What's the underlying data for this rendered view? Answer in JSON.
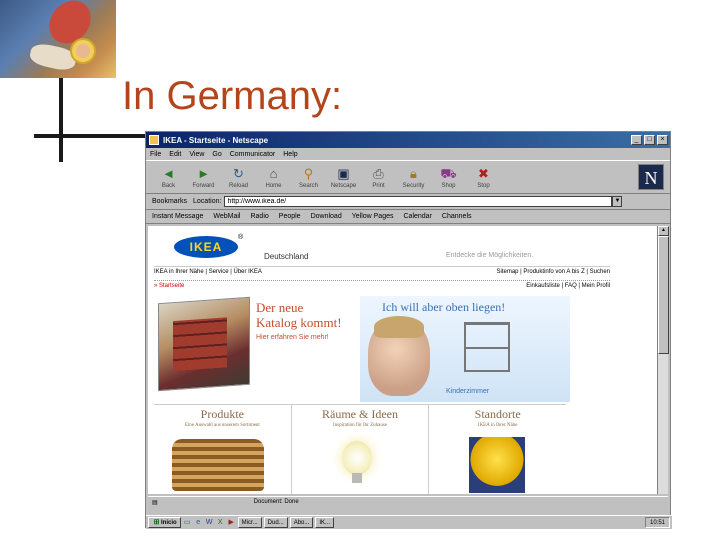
{
  "slide": {
    "title": "In Germany:"
  },
  "browser": {
    "window_title": "IKEA - Startseite - Netscape",
    "menu": [
      "File",
      "Edit",
      "View",
      "Go",
      "Communicator",
      "Help"
    ],
    "toolbar": [
      {
        "label": "Back",
        "icon": "back-icon"
      },
      {
        "label": "Forward",
        "icon": "forward-icon"
      },
      {
        "label": "Reload",
        "icon": "reload-icon"
      },
      {
        "label": "Home",
        "icon": "home-icon"
      },
      {
        "label": "Search",
        "icon": "search-icon"
      },
      {
        "label": "Netscape",
        "icon": "netscape-icon"
      },
      {
        "label": "Print",
        "icon": "print-icon"
      },
      {
        "label": "Security",
        "icon": "security-icon"
      },
      {
        "label": "Shop",
        "icon": "shop-icon"
      },
      {
        "label": "Stop",
        "icon": "stop-icon"
      }
    ],
    "bookmarks_label": "Bookmarks",
    "location_label": "Location:",
    "url": "http://www.ikea.de/",
    "personal": [
      "Instant Message",
      "WebMail",
      "Radio",
      "People",
      "Download",
      "Yellow Pages",
      "Calendar",
      "Channels"
    ],
    "status_text": "Document: Done"
  },
  "ikea": {
    "logo": "IKEA",
    "reg": "®",
    "country": "Deutschland",
    "discover": "Entdecke die Möglichkeiten.",
    "nav_left": "IKEA in Ihrer Nähe | Service | Über IKEA",
    "nav_right": "Sitemap | Produktinfo von A bis Z | Suchen",
    "nav2_left": "» Startseite",
    "nav2_right": "Einkaufsliste | FAQ | Mein Profil",
    "catalog_title_1": "Der neue",
    "catalog_title_2": "Katalog kommt!",
    "catalog_sub": "Hier erfahren Sie mehr!",
    "kids_title": "Ich will aber oben liegen!",
    "kids_label": "Kinderzimmer",
    "categories": [
      {
        "title": "Produkte",
        "sub": "Eine Auswahl aus unserem Sortiment"
      },
      {
        "title": "Räume & Ideen",
        "sub": "Inspiration für Ihr Zuhause"
      },
      {
        "title": "Standorte",
        "sub": "IKEA in Ihrer Nähe"
      }
    ]
  },
  "taskbar": {
    "start": "Inicio",
    "items": [
      "Micr...",
      "Dud...",
      "Abo...",
      "IK..."
    ],
    "clock": "10:51"
  }
}
